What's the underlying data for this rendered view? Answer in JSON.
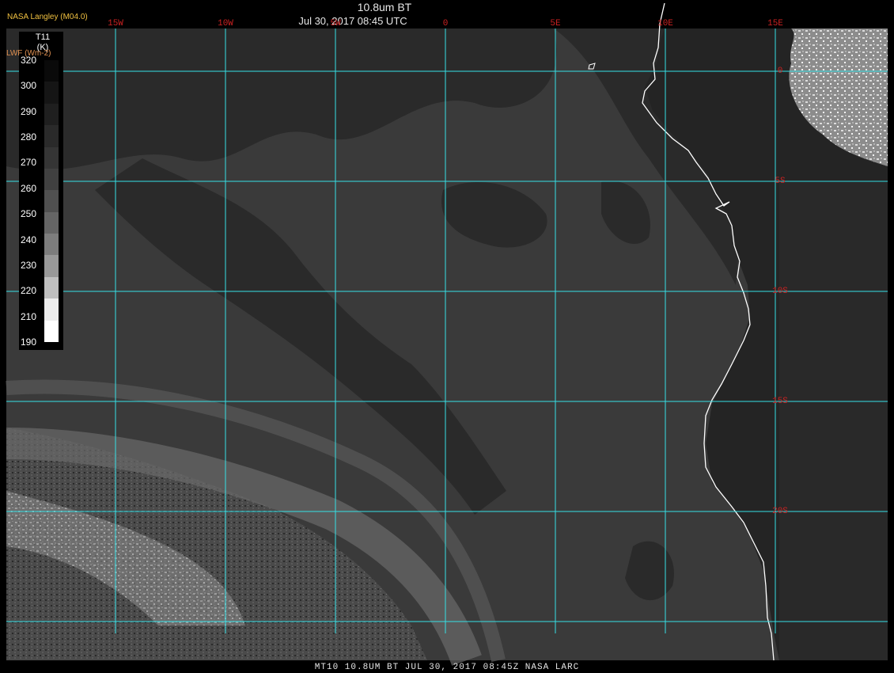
{
  "header": {
    "title": "10.8um BT",
    "datetime": "Jul 30, 2017 08:45 UTC",
    "org": "NASA Langley (M04.0)",
    "lwf_label": "LWF (Wm-2)"
  },
  "colorbar": {
    "title": "T11",
    "unit": "(K)",
    "tick_labels": [
      "320",
      "300",
      "290",
      "280",
      "270",
      "260",
      "250",
      "240",
      "230",
      "220",
      "210",
      "190"
    ],
    "swatch_colors": [
      "#0a0a0a",
      "#151515",
      "#1f1f1f",
      "#2a2a2a",
      "#353535",
      "#404040",
      "#505050",
      "#656565",
      "#7d7d7d",
      "#999999",
      "#bfbfbf",
      "#ececec",
      "#ffffff"
    ]
  },
  "graticule": {
    "color": "#35e0e6",
    "lon_labels": [
      {
        "text": "15W",
        "lon": -15
      },
      {
        "text": "10W",
        "lon": -10
      },
      {
        "text": "5W",
        "lon": -5
      },
      {
        "text": "0",
        "lon": 0
      },
      {
        "text": "5E",
        "lon": 5
      },
      {
        "text": "10E",
        "lon": 10
      },
      {
        "text": "15E",
        "lon": 15
      }
    ],
    "lat_labels": [
      {
        "text": "0",
        "lat": 0
      },
      {
        "text": "5S",
        "lat": -5
      },
      {
        "text": "10S",
        "lat": -10
      },
      {
        "text": "15S",
        "lat": -15
      },
      {
        "text": "20S",
        "lat": -20
      }
    ],
    "label_color": "#cc2222"
  },
  "map": {
    "background": "#3a3a3a",
    "coastline_color": "#ffffff"
  },
  "footer": {
    "text": "MT10  10.8UM BT   JUL 30, 2017 08:45Z   NASA LARC"
  }
}
